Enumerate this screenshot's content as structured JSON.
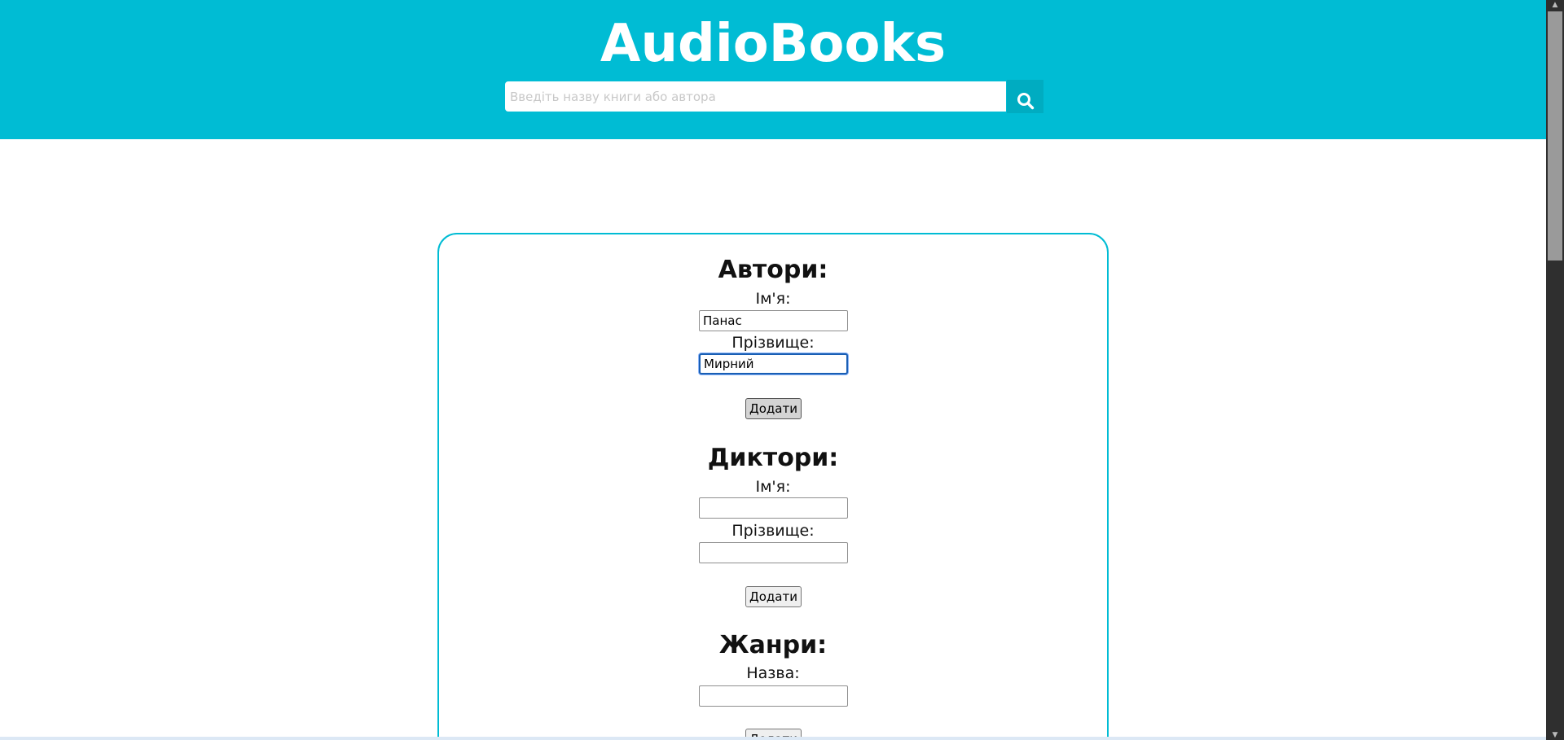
{
  "header": {
    "title": "AudioBooks",
    "search_placeholder": "Введіть назву книги або автора",
    "search_icon": "search-icon"
  },
  "sections": {
    "authors": {
      "heading": "Автори:",
      "first_name_label": "Ім'я:",
      "first_name_value": "Панас",
      "last_name_label": "Прізвище:",
      "last_name_value": "Мирний",
      "add_label": "Додати"
    },
    "narrators": {
      "heading": "Диктори:",
      "first_name_label": "Ім'я:",
      "first_name_value": "",
      "last_name_label": "Прізвище:",
      "last_name_value": "",
      "add_label": "Додати"
    },
    "genres": {
      "heading": "Жанри:",
      "name_label": "Назва:",
      "name_value": "",
      "add_label": "Додати"
    }
  },
  "colors": {
    "accent": "#00bcd4",
    "search_button": "#00acc1"
  }
}
